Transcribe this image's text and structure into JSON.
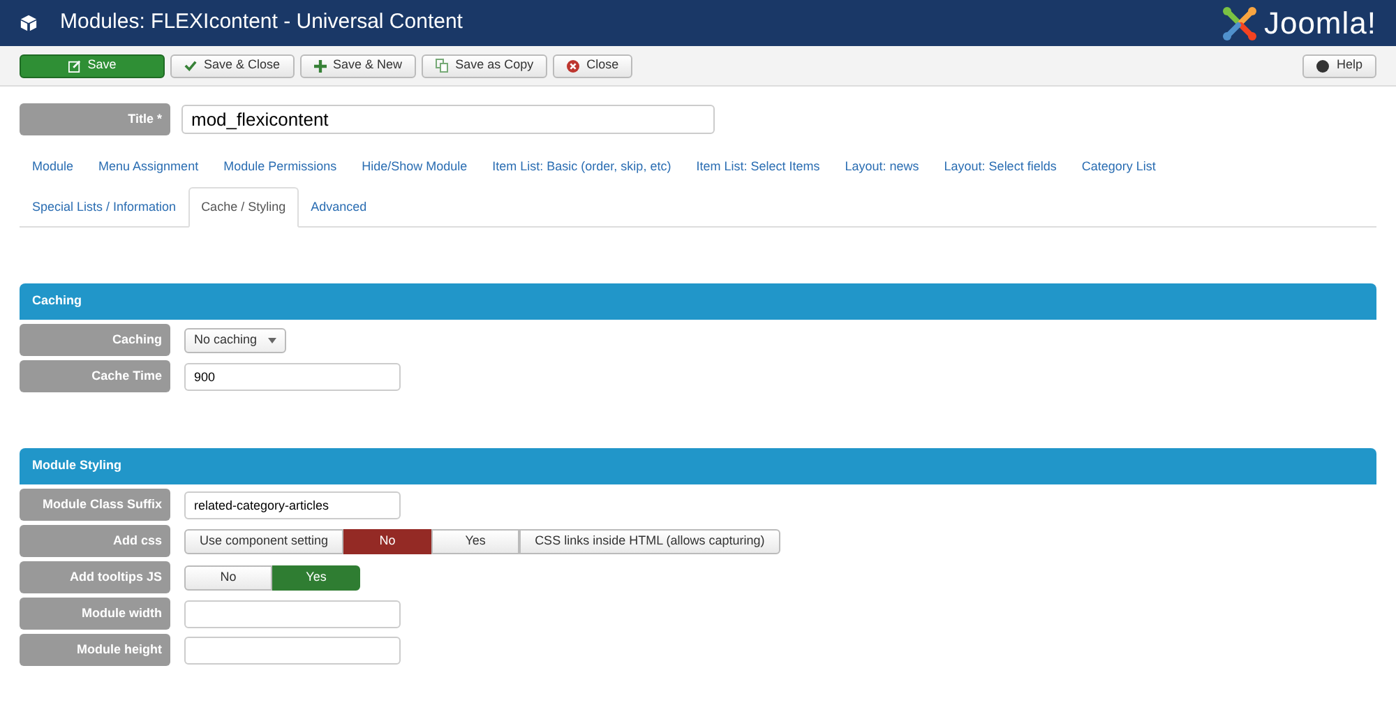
{
  "header": {
    "title": "Modules: FLEXIcontent - Universal Content",
    "logo_text": "Joomla!"
  },
  "toolbar": {
    "buttons": [
      {
        "label": "Save",
        "kind": "primary"
      },
      {
        "label": "Save & Close",
        "kind": "check"
      },
      {
        "label": "Save & New",
        "kind": "plus"
      },
      {
        "label": "Save as Copy",
        "kind": "copy"
      },
      {
        "label": "Close",
        "kind": "close"
      }
    ],
    "help": "Help"
  },
  "title_field": {
    "label": "Title *",
    "value": "mod_flexicontent"
  },
  "tabs": [
    {
      "label": "Module",
      "selected": false
    },
    {
      "label": "Menu Assignment",
      "selected": false
    },
    {
      "label": "Module Permissions",
      "selected": false
    },
    {
      "label": "Hide/Show Module",
      "selected": false
    },
    {
      "label": "Item List: Basic (order, skip, etc)",
      "selected": false
    },
    {
      "label": "Item List: Select Items",
      "selected": false
    },
    {
      "label": "Layout: news",
      "selected": false
    },
    {
      "label": "Layout: Select fields",
      "selected": false
    },
    {
      "label": "Category List",
      "selected": false
    },
    {
      "label": "Special Lists / Information",
      "selected": false
    },
    {
      "label": "Cache / Styling",
      "selected": true
    },
    {
      "label": "Advanced",
      "selected": false
    }
  ],
  "sections": [
    {
      "title": "Caching",
      "fields": [
        {
          "label": "Caching",
          "kind": "select",
          "value": "No caching"
        },
        {
          "label": "Cache Time",
          "kind": "text",
          "value": "900"
        }
      ]
    },
    {
      "title": "Module Styling",
      "fields": [
        {
          "label": "Module Class Suffix",
          "kind": "text",
          "value": "related-category-articles"
        },
        {
          "label": "Add css",
          "kind": "radio",
          "options": [
            {
              "label": "Use component setting",
              "selected": false
            },
            {
              "label": "No",
              "selected": true,
              "color": "#942a25"
            },
            {
              "label": "Yes",
              "selected": false
            },
            {
              "label": "CSS links inside HTML (allows capturing)",
              "selected": false
            }
          ]
        },
        {
          "label": "Add tooltips JS",
          "kind": "radio",
          "options": [
            {
              "label": "No",
              "selected": false
            },
            {
              "label": "Yes",
              "selected": true,
              "color": "#2f7d32"
            }
          ]
        },
        {
          "label": "Module width",
          "kind": "text"
        },
        {
          "label": "Module height",
          "kind": "text"
        }
      ]
    }
  ]
}
